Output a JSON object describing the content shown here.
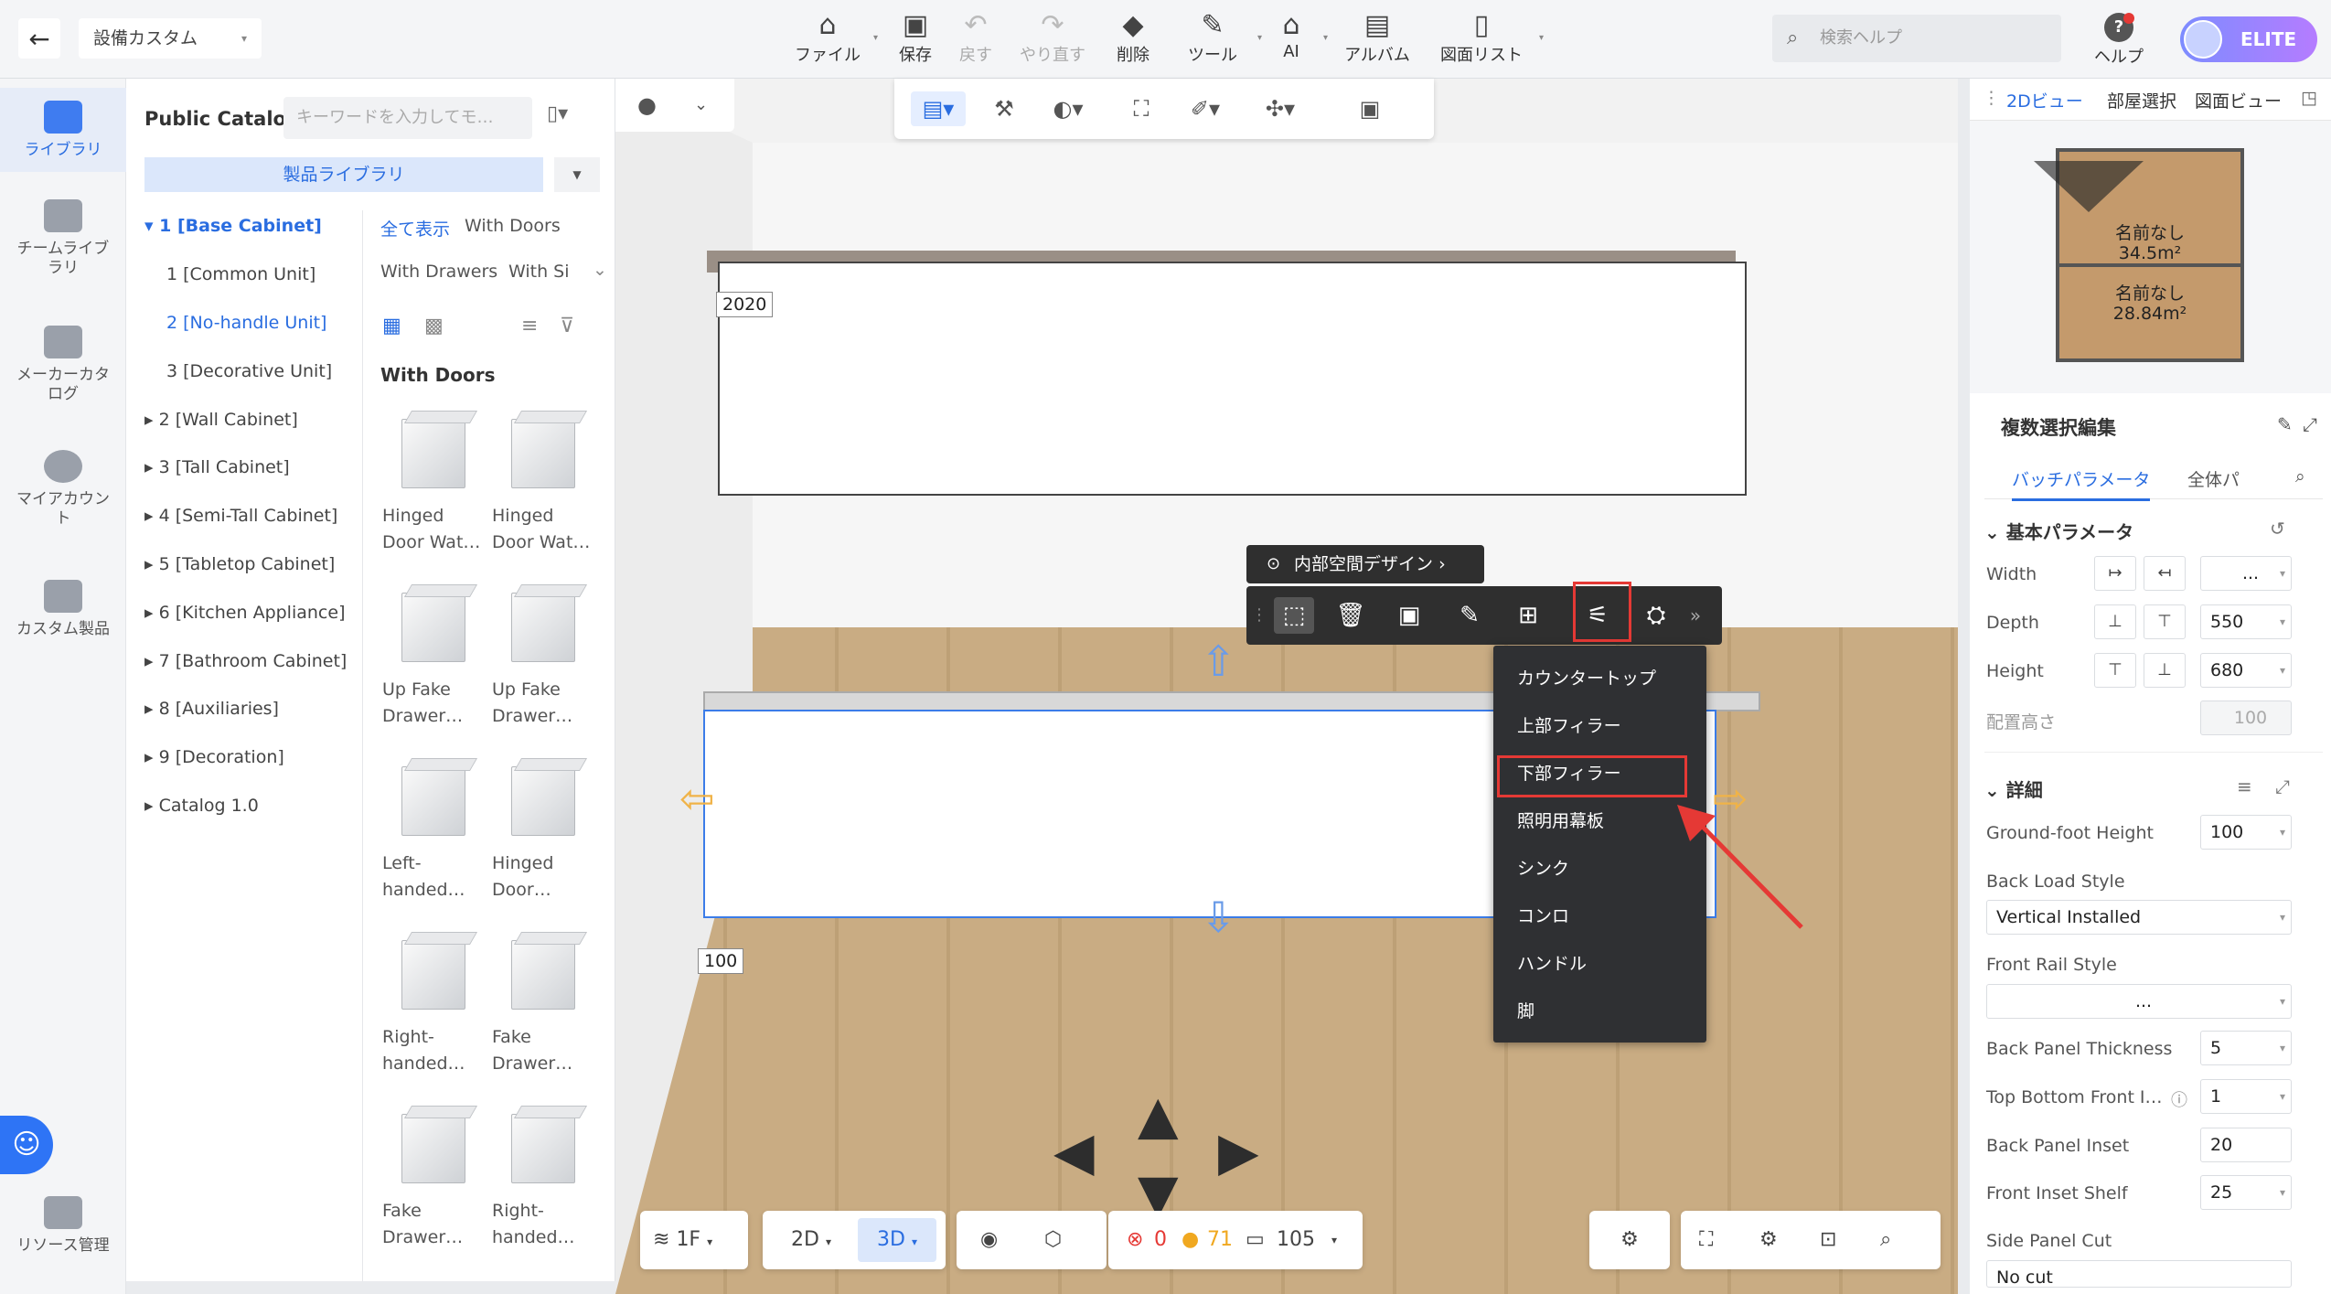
{
  "header": {
    "project_name": "設備カスタム",
    "toolbar": [
      {
        "label": "ファイル",
        "icon": "file-icon",
        "disabled": false
      },
      {
        "label": "保存",
        "icon": "save-icon",
        "disabled": false
      },
      {
        "label": "戻す",
        "icon": "undo-icon",
        "disabled": true
      },
      {
        "label": "やり直す",
        "icon": "redo-icon",
        "disabled": true
      },
      {
        "label": "削除",
        "icon": "eraser-icon",
        "disabled": false
      },
      {
        "label": "ツール",
        "icon": "wrench-icon",
        "disabled": false
      },
      {
        "label": "AI",
        "icon": "ai-icon",
        "disabled": false
      },
      {
        "label": "アルバム",
        "icon": "album-icon",
        "disabled": false
      },
      {
        "label": "図面リスト",
        "icon": "drawing-list-icon",
        "disabled": false
      }
    ],
    "search_placeholder": "検索ヘルプ",
    "help_label": "ヘルプ",
    "elite_label": "ELITE"
  },
  "leftnav": [
    {
      "label": "ライブラリ",
      "icon": "library-icon",
      "active": true
    },
    {
      "label": "チームライブラリ",
      "icon": "team-library-icon",
      "active": false
    },
    {
      "label": "メーカーカタログ",
      "icon": "maker-catalog-icon",
      "active": false
    },
    {
      "label": "マイアカウント",
      "icon": "account-icon",
      "active": false
    },
    {
      "label": "カスタム製品",
      "icon": "custom-product-icon",
      "active": false
    },
    {
      "label": "リソース管理",
      "icon": "resource-icon",
      "active": false
    }
  ],
  "catalog": {
    "title": "Public Catalog",
    "search_placeholder": "キーワードを入力してモ…",
    "library_button": "製品ライブラリ",
    "tree": [
      {
        "label": "1 [Base Cabinet]",
        "level": 0,
        "expanded": true,
        "active": true
      },
      {
        "label": "1 [Common Unit]",
        "level": 1,
        "active": false
      },
      {
        "label": "2 [No-handle Unit]",
        "level": 1,
        "active": true
      },
      {
        "label": "3 [Decorative Unit]",
        "level": 1,
        "active": false
      },
      {
        "label": "2 [Wall Cabinet]",
        "level": 0,
        "active": false
      },
      {
        "label": "3 [Tall Cabinet]",
        "level": 0,
        "active": false
      },
      {
        "label": "4 [Semi-Tall Cabinet]",
        "level": 0,
        "active": false
      },
      {
        "label": "5 [Tabletop Cabinet]",
        "level": 0,
        "active": false
      },
      {
        "label": "6 [Kitchen Appliance]",
        "level": 0,
        "active": false
      },
      {
        "label": "7 [Bathroom Cabinet]",
        "level": 0,
        "active": false
      },
      {
        "label": "8 [Auxiliaries]",
        "level": 0,
        "active": false
      },
      {
        "label": "9 [Decoration]",
        "level": 0,
        "active": false
      },
      {
        "label": "Catalog 1.0",
        "level": 0,
        "active": false
      }
    ],
    "filters": [
      "全て表示",
      "With Doors",
      "With Drawers",
      "With Si"
    ],
    "section_title": "With Doors",
    "products": [
      {
        "line1": "Hinged",
        "line2": "Door Wat…"
      },
      {
        "line1": "Hinged",
        "line2": "Door Wat…"
      },
      {
        "line1": "Up Fake",
        "line2": "Drawer…"
      },
      {
        "line1": "Up Fake",
        "line2": "Drawer…"
      },
      {
        "line1": "Left-",
        "line2": "handed…"
      },
      {
        "line1": "Hinged",
        "line2": "Door…"
      },
      {
        "line1": "Right-",
        "line2": "handed…"
      },
      {
        "line1": "Fake",
        "line2": "Drawer…"
      },
      {
        "line1": "Fake",
        "line2": "Drawer…"
      },
      {
        "line1": "Right-",
        "line2": "handed…"
      }
    ]
  },
  "viewport": {
    "dim_upper": "2020",
    "dim_lower": "100",
    "context_title": "内部空間デザイン",
    "menu_items": [
      "カウンタートップ",
      "上部フィラー",
      "下部フィラー",
      "照明用幕板",
      "シンク",
      "コンロ",
      "ハンドル",
      "脚"
    ],
    "highlighted_menu_item": "下部フィラー",
    "floor_label": "1F",
    "view_2d": "2D",
    "view_3d": "3D",
    "errors": "0",
    "warnings": "71",
    "items_count": "105",
    "colors": {
      "accent": "#2a6de0",
      "highlight": "#e53935",
      "selection": "#3b7ce8",
      "floor": "#c9ac83"
    }
  },
  "right": {
    "tabs": [
      "2Dビュー",
      "部屋選択",
      "図面ビュー"
    ],
    "rooms": [
      {
        "name": "名前なし",
        "area": "34.5m²"
      },
      {
        "name": "名前なし",
        "area": "28.84m²"
      }
    ],
    "editor_title": "複数選択編集",
    "editor_tabs": [
      "バッチパラメータ",
      "全体パ"
    ],
    "basic_section": "基本パラメータ",
    "width_label": "Width",
    "width_value": "...",
    "depth_label": "Depth",
    "depth_value": "550",
    "height_label": "Height",
    "height_value": "680",
    "placement_label": "配置高さ",
    "placement_value": "100",
    "detail_section": "詳細",
    "ground_foot_label": "Ground-foot Height",
    "ground_foot_value": "100",
    "back_load_label": "Back Load Style",
    "back_load_value": "Vertical Installed",
    "front_rail_label": "Front Rail Style",
    "front_rail_value": "...",
    "back_panel_thk_label": "Back Panel Thickness",
    "back_panel_thk_value": "5",
    "top_bottom_label": "Top Bottom Front I…",
    "top_bottom_value": "1",
    "back_panel_inset_label": "Back Panel Inset",
    "back_panel_inset_value": "20",
    "front_inset_label": "Front Inset Shelf",
    "front_inset_value": "25",
    "side_panel_cut_label": "Side Panel Cut",
    "side_panel_cut_value": "No cut"
  }
}
